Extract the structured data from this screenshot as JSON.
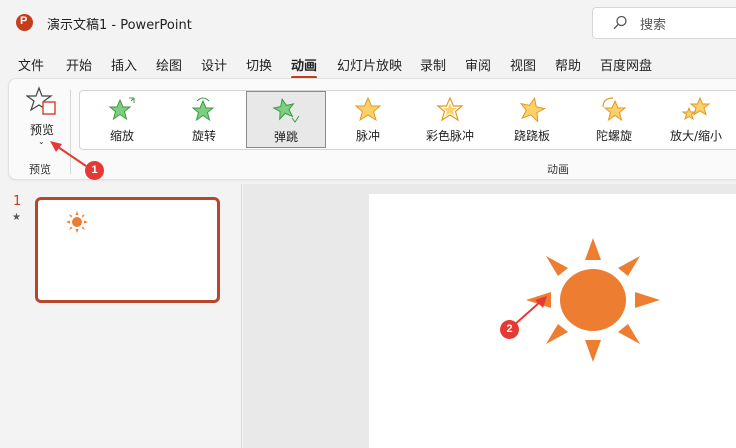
{
  "window": {
    "title": "演示文稿1  -  PowerPoint",
    "search_placeholder": "搜索"
  },
  "menu": {
    "tabs": [
      "文件",
      "开始",
      "插入",
      "绘图",
      "设计",
      "切换",
      "动画",
      "幻灯片放映",
      "录制",
      "审阅",
      "视图",
      "帮助",
      "百度网盘"
    ],
    "active_tab": "动画"
  },
  "ribbon": {
    "preview": {
      "label": "预览",
      "group_label": "预览"
    },
    "animations_group_label": "动画",
    "effects": [
      {
        "label": "缩放",
        "icon": "zoom-star-icon",
        "color": "#5cb85c"
      },
      {
        "label": "旋转",
        "icon": "spin-star-icon",
        "color": "#5cb85c"
      },
      {
        "label": "弹跳",
        "icon": "bounce-star-icon",
        "color": "#5cb85c",
        "selected": true
      },
      {
        "label": "脉冲",
        "icon": "pulse-star-icon",
        "color": "#f0a830"
      },
      {
        "label": "彩色脉冲",
        "icon": "color-pulse-star-icon",
        "color": "#f0a830"
      },
      {
        "label": "跷跷板",
        "icon": "teeter-star-icon",
        "color": "#f0a830"
      },
      {
        "label": "陀螺旋",
        "icon": "spin-star-icon",
        "color": "#f0a830"
      },
      {
        "label": "放大/缩小",
        "icon": "grow-shrink-star-icon",
        "color": "#f0a830"
      }
    ]
  },
  "slides_pane": {
    "slide_number": "1",
    "has_animation_marker": "★"
  },
  "annotations": [
    {
      "number": "1"
    },
    {
      "number": "2"
    }
  ],
  "colors": {
    "accent": "#c43e1c",
    "sun": "#ed7d31",
    "badge": "#e53935"
  }
}
